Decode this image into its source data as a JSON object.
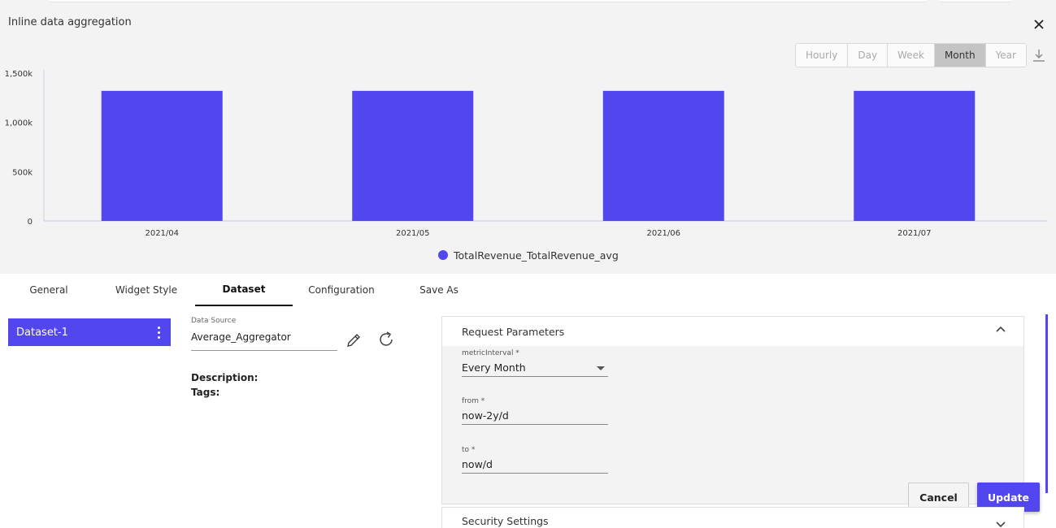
{
  "preview": {
    "title": "Inline data aggregation",
    "intervals": [
      "Hourly",
      "Day",
      "Week",
      "Month",
      "Year"
    ],
    "active_interval": "Month"
  },
  "chart_data": {
    "type": "bar",
    "categories": [
      "2021/04",
      "2021/05",
      "2021/06",
      "2021/07"
    ],
    "series": [
      {
        "name": "TotalRevenue_TotalRevenue_avg",
        "values": [
          1320,
          1320,
          1320,
          1320
        ]
      }
    ],
    "yticks": [
      "0",
      "500k",
      "1,000k",
      "1,500k"
    ],
    "ytick_values": [
      0,
      500,
      1000,
      1500
    ],
    "ylim": [
      0,
      1500
    ],
    "legend_position": "bottom-center",
    "color": "#5246ee"
  },
  "tabs": [
    {
      "label": "General"
    },
    {
      "label": "Widget Style"
    },
    {
      "label": "Dataset"
    },
    {
      "label": "Configuration"
    },
    {
      "label": "Save As"
    }
  ],
  "active_tab": "Dataset",
  "dataset": {
    "item_label": "Dataset-1",
    "data_source_label": "Data Source",
    "data_source_value": "Average_Aggregator",
    "description_label": "Description:",
    "tags_label": "Tags:"
  },
  "request_parameters": {
    "title": "Request Parameters",
    "metric_interval_label": "metricInterval *",
    "metric_interval_value": "Every Month",
    "from_label": "from *",
    "from_value": "now-2y/d",
    "to_label": "to *",
    "to_value": "now/d"
  },
  "security": {
    "title": "Security Settings"
  },
  "actions": {
    "cancel": "Cancel",
    "update": "Update"
  },
  "colors": {
    "accent": "#5246ee"
  }
}
